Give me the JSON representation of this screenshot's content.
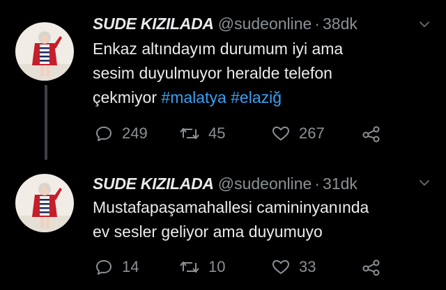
{
  "tweets": [
    {
      "author_name": "SUDE KIZILADA",
      "handle": "@sudeonline",
      "separator": "·",
      "time": "38dk",
      "text_lines": [
        "Enkaz altındayım durumum iyi ama",
        "sesim duyulmuyor heralde telefon",
        "çekmiyor"
      ],
      "hashtags": [
        "#malatya",
        "#elaziğ"
      ],
      "replies": "249",
      "retweets": "45",
      "likes": "267"
    },
    {
      "author_name": "SUDE KIZILADA",
      "handle": "@sudeonline",
      "separator": "·",
      "time": "31dk",
      "text_lines": [
        "Mustafapaşamahallesi camininyanında",
        "ev sesler geliyor ama duyumuyo"
      ],
      "replies": "14",
      "retweets": "10",
      "likes": "33"
    }
  ],
  "icons": {
    "reply": "reply-icon",
    "retweet": "retweet-icon",
    "like": "heart-icon",
    "share": "share-icon",
    "menu": "chevron-down-icon"
  },
  "colors": {
    "background": "#000000",
    "text": "#e8eaeb",
    "muted": "#8b9196",
    "hashtag": "#38a1f3"
  }
}
